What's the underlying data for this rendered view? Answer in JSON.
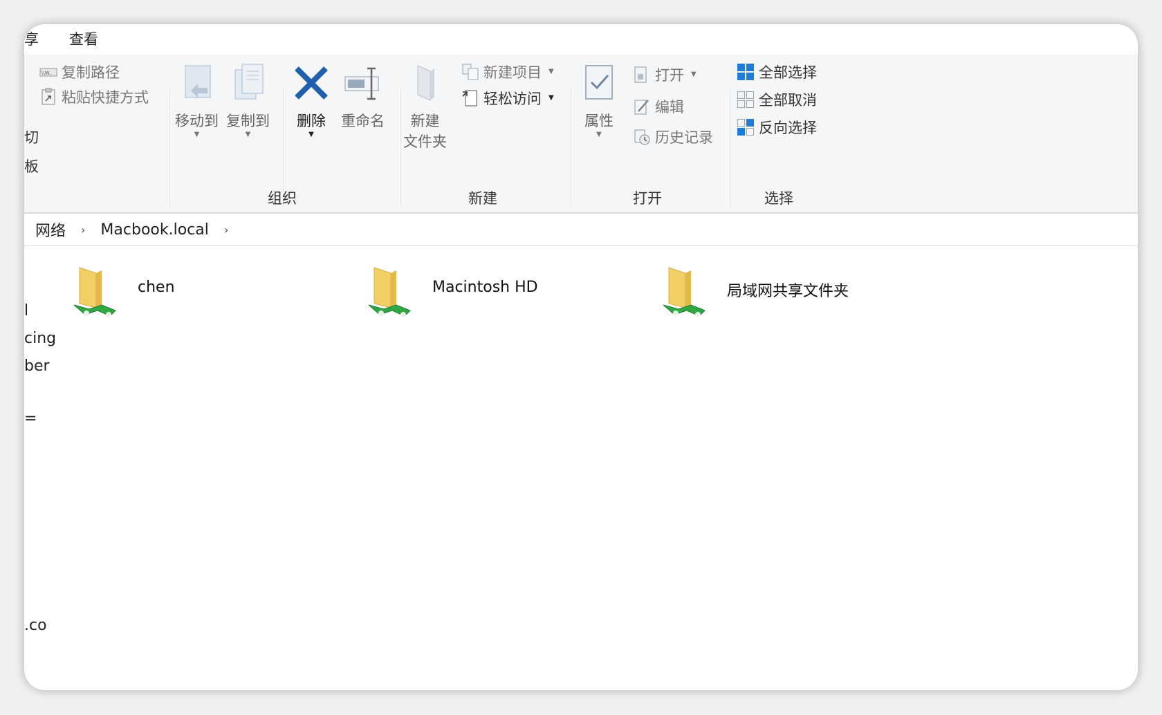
{
  "tabs": {
    "partial": "享",
    "view": "查看"
  },
  "ribbon": {
    "clipboard": {
      "copy_path": "复制路径",
      "paste_shortcut": "粘贴快捷方式",
      "cut_partial": "切",
      "board_partial": "板"
    },
    "organize": {
      "move_to": "移动到",
      "copy_to": "复制到",
      "delete": "删除",
      "rename": "重命名",
      "label": "组织"
    },
    "new": {
      "new_folder": "新建\n文件夹",
      "new_item": "新建项目",
      "easy_access": "轻松访问",
      "label": "新建"
    },
    "open": {
      "properties": "属性",
      "open": "打开",
      "edit": "编辑",
      "history": "历史记录",
      "label": "打开"
    },
    "select": {
      "select_all": "全部选择",
      "select_none": "全部取消",
      "invert": "反向选择",
      "label": "选择"
    }
  },
  "address": {
    "crumbs": [
      "网络",
      "Macbook.local"
    ]
  },
  "nav_partial": {
    "a": "l",
    "b": "cing",
    "c": "ber",
    "d": "=",
    "e": ".co"
  },
  "folders": [
    {
      "name": "chen"
    },
    {
      "name": "Macintosh HD"
    },
    {
      "name": "局域网共享文件夹"
    }
  ],
  "colors": {
    "delete_x": "#1f5fae",
    "select_blue": "#1e7bd6",
    "folder_yellow": "#f1cf64",
    "net_green": "#2fa844"
  }
}
